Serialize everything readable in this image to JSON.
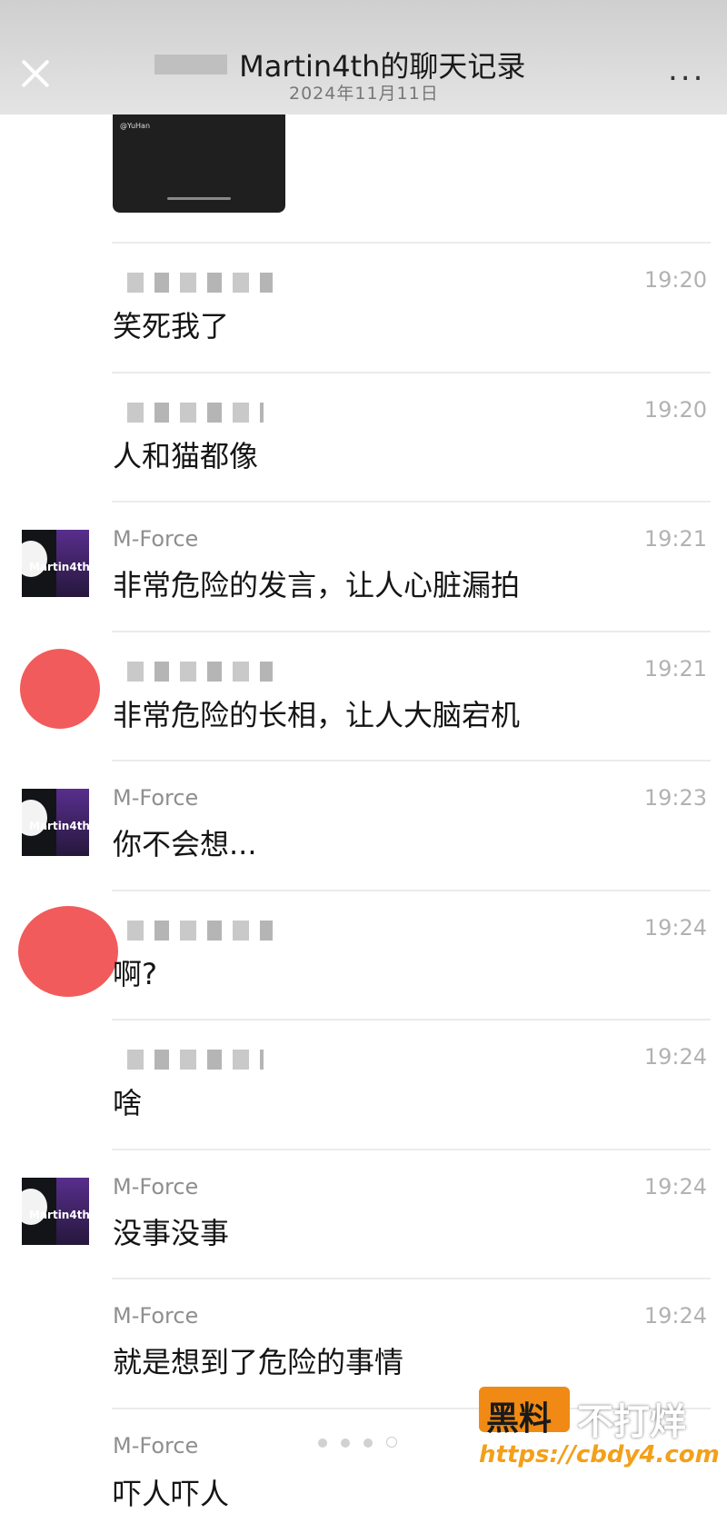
{
  "header": {
    "title": "Martin4th的聊天记录",
    "date": "2024年11月11日",
    "close_icon": "close-icon",
    "more_icon": "more-icon",
    "more_label": "..."
  },
  "preview_card": {
    "user": "@YuHan",
    "subtitle": ""
  },
  "messages": [
    {
      "sender": "",
      "time": "19:20",
      "text": "笑死我了"
    },
    {
      "sender": "",
      "time": "19:20",
      "text": "人和猫都像"
    },
    {
      "sender": "M-Force",
      "time": "19:21",
      "text": "非常危险的发言，让人心脏漏拍"
    },
    {
      "sender": "",
      "time": "19:21",
      "text": "非常危险的长相，让人大脑宕机"
    },
    {
      "sender": "M-Force",
      "time": "19:23",
      "text": "你不会想..."
    },
    {
      "sender": "",
      "time": "19:24",
      "text": "啊?"
    },
    {
      "sender": "",
      "time": "19:24",
      "text": "啥"
    },
    {
      "sender": "M-Force",
      "time": "19:24",
      "text": "没事没事"
    },
    {
      "sender": "M-Force",
      "time": "19:24",
      "text": "就是想到了危险的事情"
    },
    {
      "sender": "M-Force",
      "time": "",
      "text": "吓人吓人"
    }
  ],
  "avatar_label": "Martin4th",
  "watermark": {
    "part1": "黑料",
    "part2": "不打烊",
    "url": "https://cbdy4.com"
  }
}
